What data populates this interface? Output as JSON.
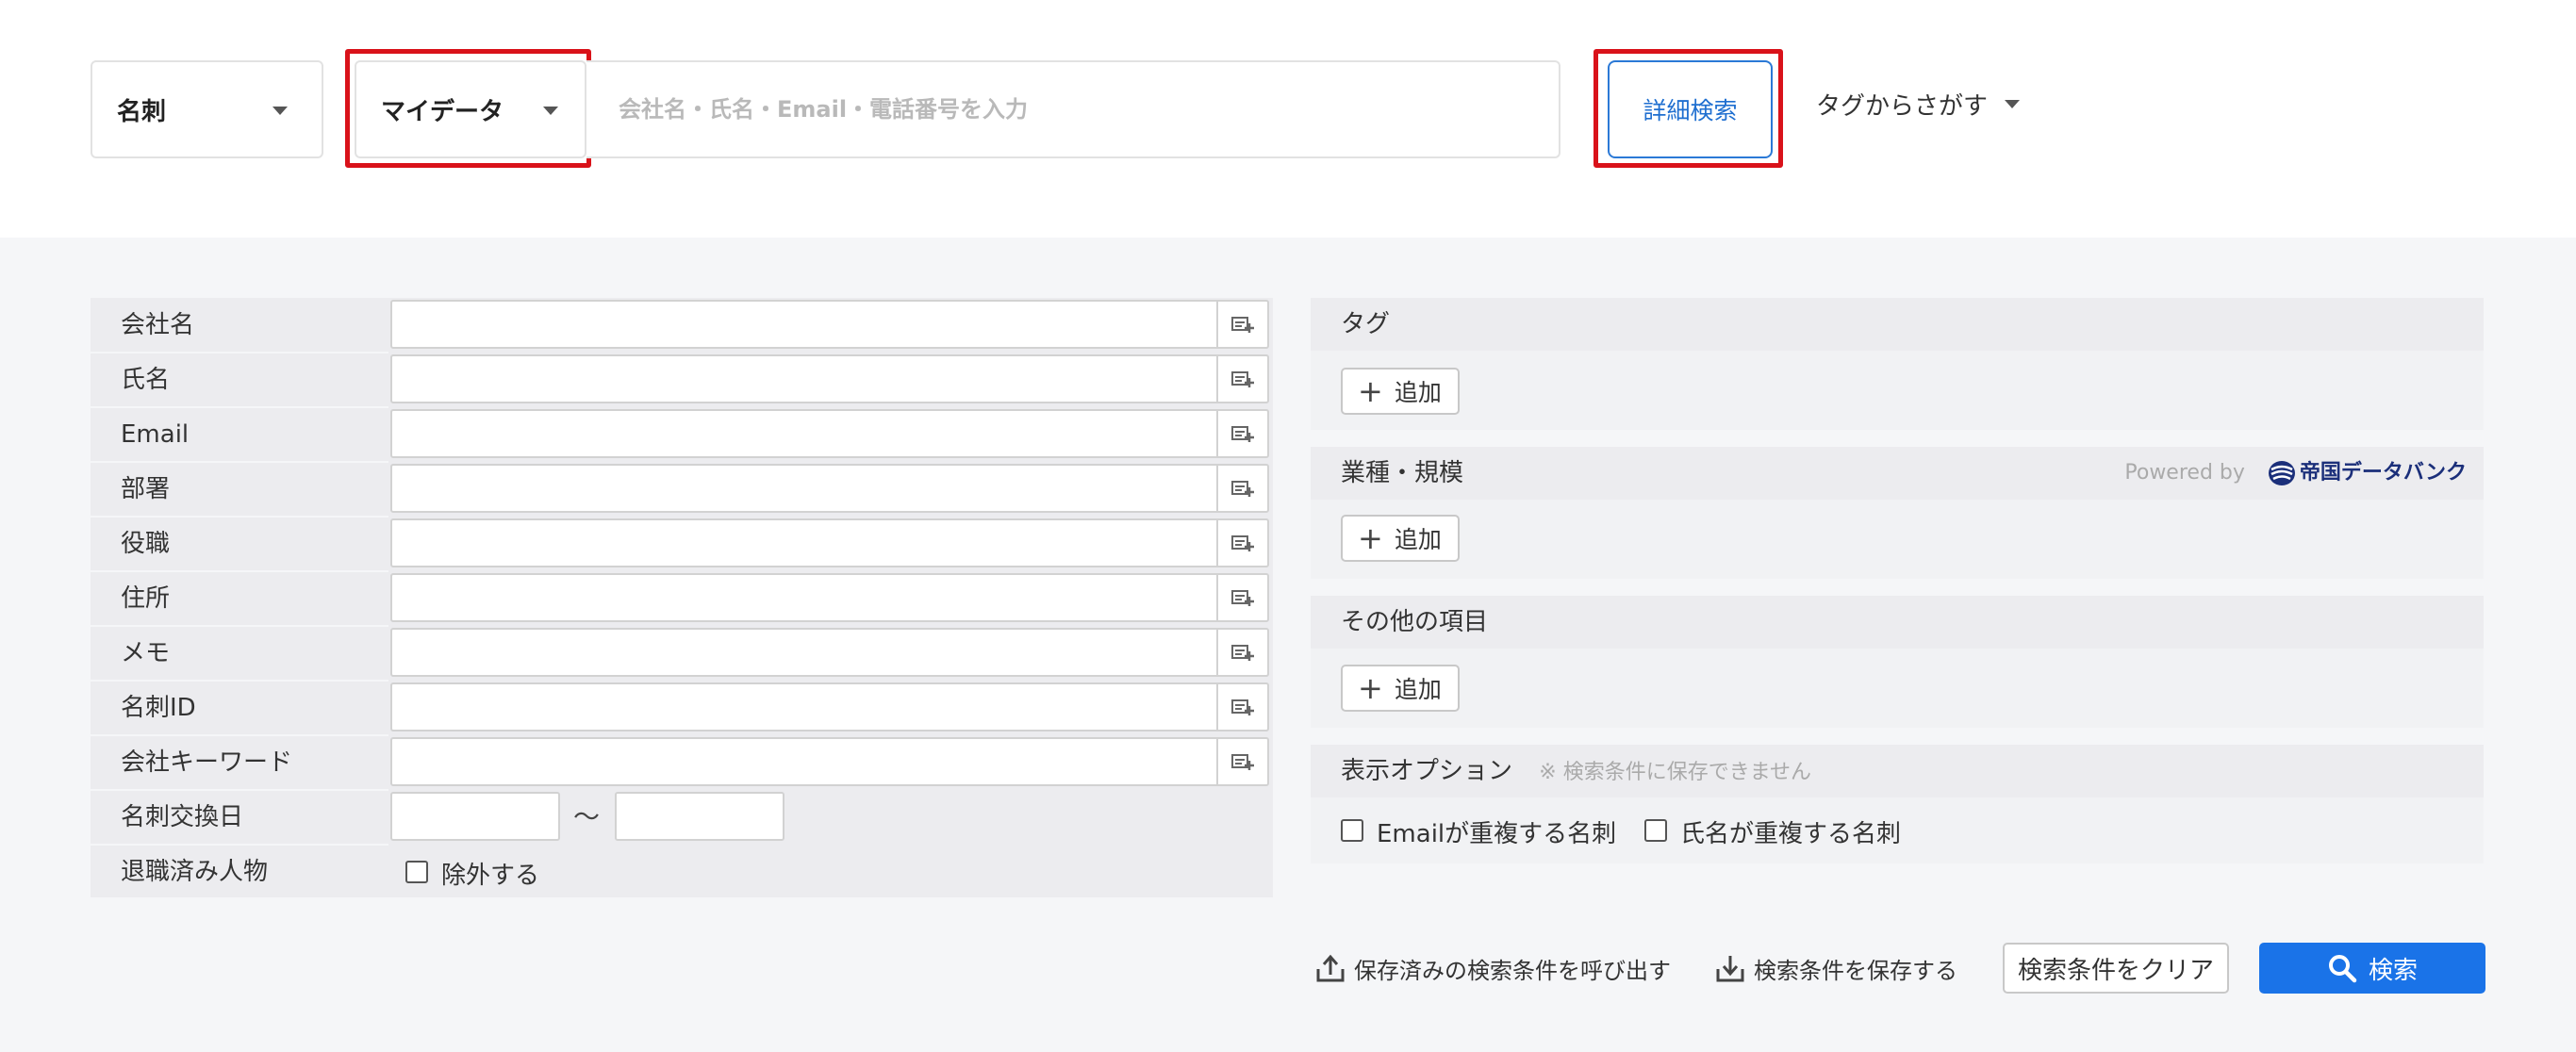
{
  "search_bar": {
    "type_dropdown": "名刺",
    "scope_dropdown": "マイデータ",
    "quick_input_placeholder": "会社名・氏名・Email・電話番号を入力",
    "quick_input_value": "",
    "advanced_search_button": "詳細検索",
    "tag_search_dropdown": "タグからさがす"
  },
  "highlight_color": "#d9121a",
  "accent_color": "#1a73e8",
  "form_fields": [
    {
      "label": "会社名",
      "value": ""
    },
    {
      "label": "氏名",
      "value": ""
    },
    {
      "label": "Email",
      "value": ""
    },
    {
      "label": "部署",
      "value": ""
    },
    {
      "label": "役職",
      "value": ""
    },
    {
      "label": "住所",
      "value": ""
    },
    {
      "label": "メモ",
      "value": ""
    },
    {
      "label": "名刺ID",
      "value": ""
    },
    {
      "label": "会社キーワード",
      "value": ""
    }
  ],
  "exchange_date": {
    "label": "名刺交換日",
    "from": "",
    "to": "",
    "separator": "〜"
  },
  "retired": {
    "label": "退職済み人物",
    "checkbox_label": "除外する",
    "checked": false
  },
  "right_sections": {
    "tags": {
      "title": "タグ",
      "add_label": "追加"
    },
    "industry": {
      "title": "業種・規模",
      "add_label": "追加",
      "powered_by": "Powered by",
      "provider_logo_text": "帝国データバンク"
    },
    "other": {
      "title": "その他の項目",
      "add_label": "追加"
    },
    "display_options": {
      "title": "表示オプション",
      "note": "※ 検索条件に保存できません",
      "options": [
        {
          "label": "Emailが重複する名刺",
          "checked": false
        },
        {
          "label": "氏名が重複する名刺",
          "checked": false
        }
      ]
    }
  },
  "actions": {
    "load_saved": "保存済みの検索条件を呼び出す",
    "save": "検索条件を保存する",
    "clear": "検索条件をクリア",
    "search": "検索"
  },
  "icons": {
    "dropdown": "caret-down-icon",
    "field_picker": "field-picker-icon",
    "add": "plus-icon",
    "load": "upload-icon",
    "save": "download-icon",
    "search": "magnifier-icon"
  }
}
